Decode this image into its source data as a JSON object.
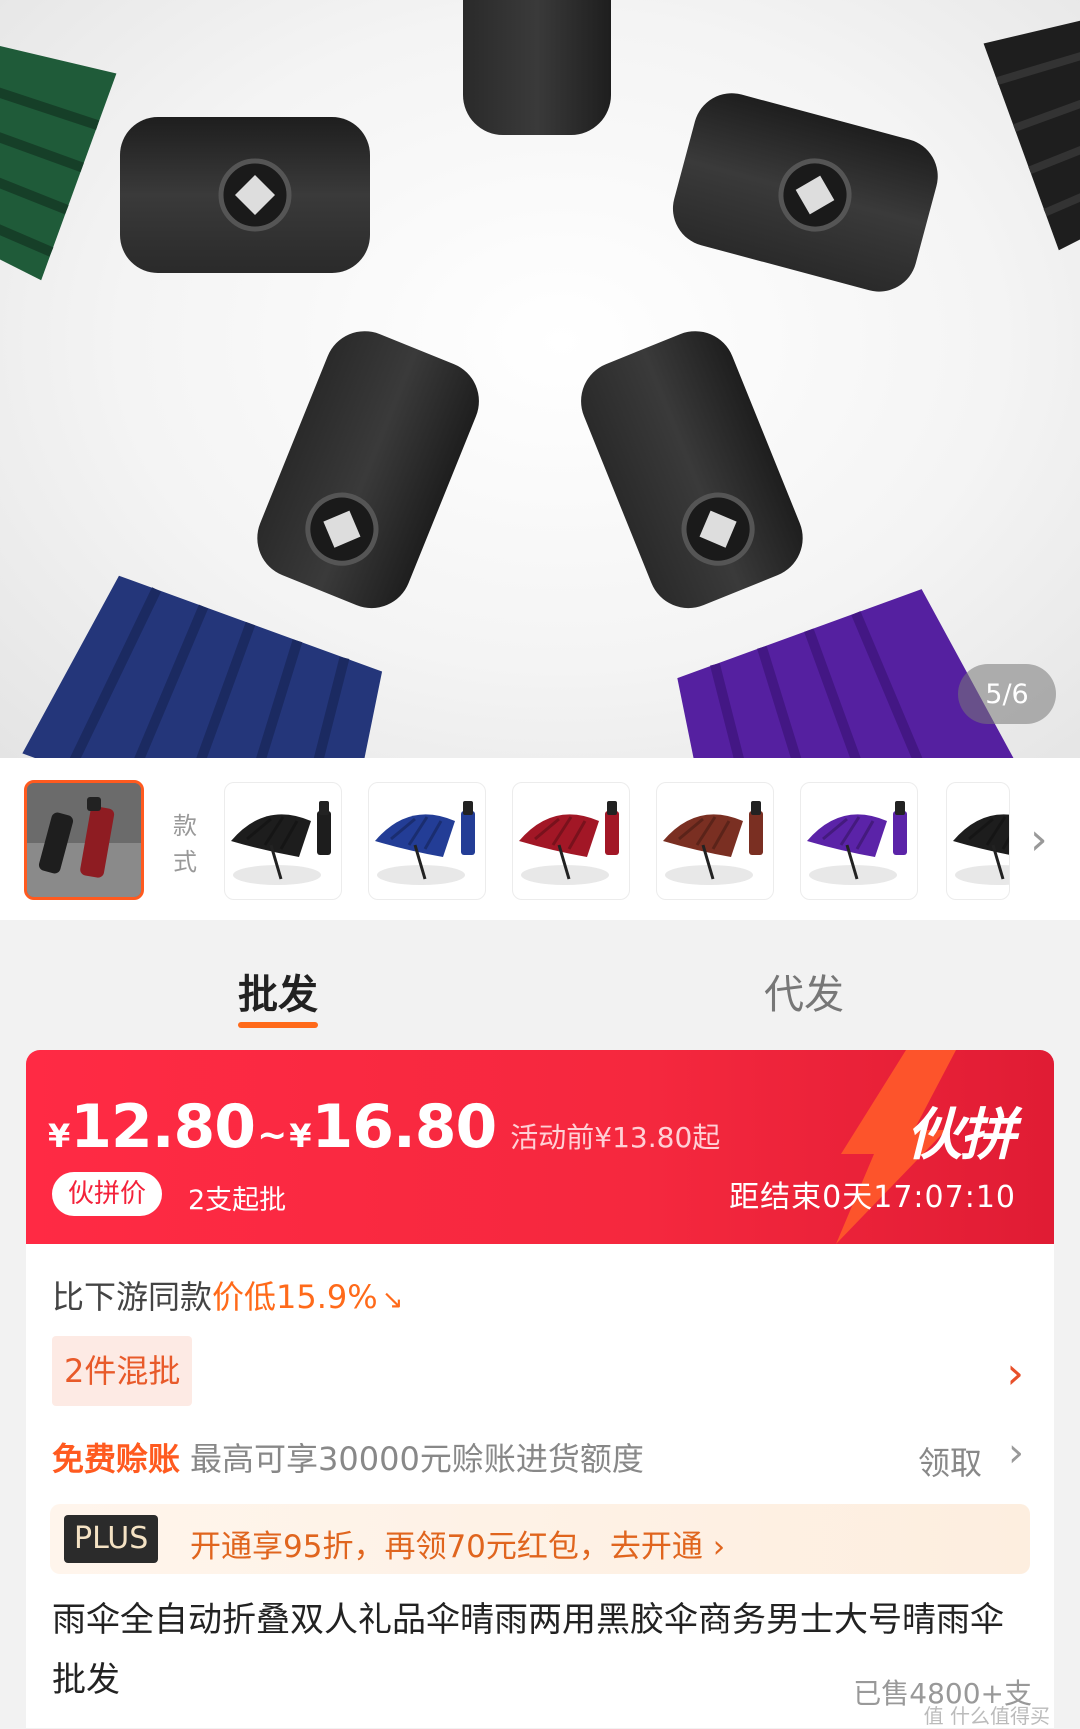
{
  "gallery": {
    "counter": "5/6",
    "style_label": "款式",
    "thumbnails": [
      {
        "name": "black",
        "canopy": "#1d1d1d"
      },
      {
        "name": "navy",
        "canopy": "#233d96"
      },
      {
        "name": "red",
        "canopy": "#a21726"
      },
      {
        "name": "brown",
        "canopy": "#7a2f22"
      },
      {
        "name": "purple",
        "canopy": "#5b23a8"
      },
      {
        "name": "black-partial",
        "canopy": "#1d1d1d"
      }
    ],
    "more_icon": "chevron-right-icon"
  },
  "tabs": {
    "wholesale": "批发",
    "dropship": "代发"
  },
  "price": {
    "currency": "¥",
    "low": "12.80",
    "separator": "~",
    "high": "16.80",
    "before": "活动前¥13.80起",
    "tag": "伙拼价",
    "min_order": "2支起批",
    "badge": "伙拼",
    "countdown": "距结束0天17:07:10"
  },
  "details": {
    "compare_prefix": "比下游同款",
    "compare_value": "价低15.9%",
    "mixed": "2件混批",
    "credit_title": "免费赊账",
    "credit_desc": "最高可享30000元赊账进货额度",
    "claim": "领取",
    "plus_badge": "PLUS",
    "plus_text": "开通享95折，再领70元红包，去开通 ›",
    "title": "雨伞全自动折叠双人礼品伞晴雨两用黑胶伞商务男士大号晴雨伞批发",
    "sold": "已售4800+支",
    "watermark": "值 什么值得买"
  },
  "colors": {
    "accent": "#ff5a1f",
    "banner": "#f5283e"
  }
}
